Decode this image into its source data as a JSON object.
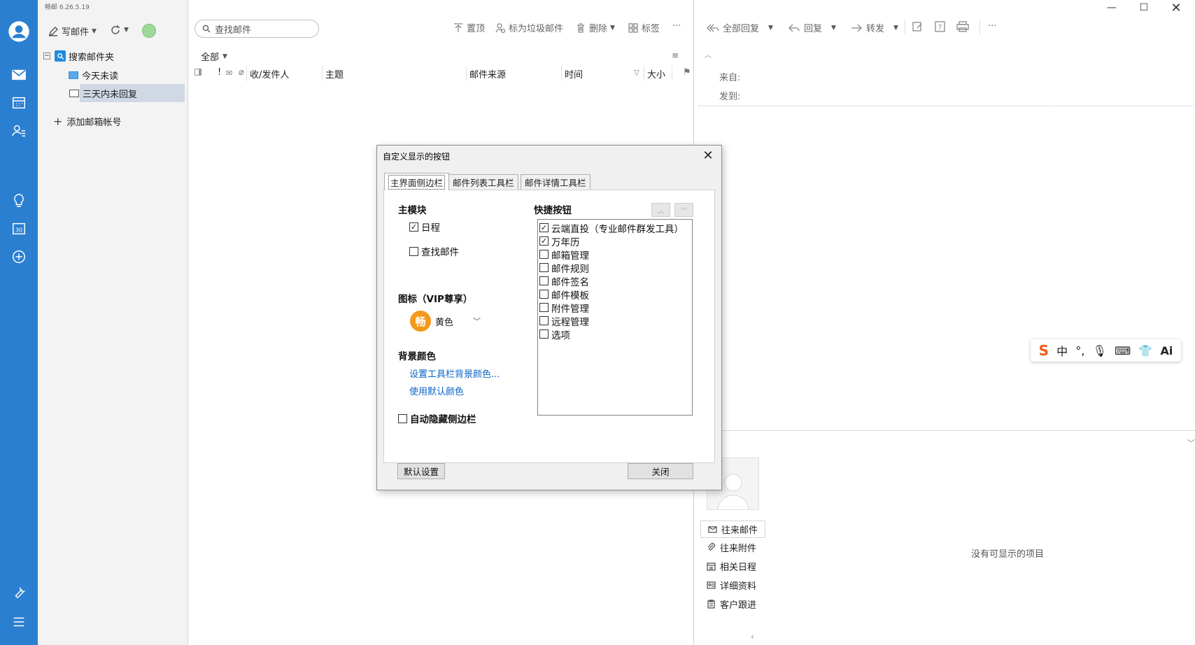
{
  "app": {
    "version": "畅邮 6.26.5.19"
  },
  "folders_toolbar": {
    "compose": "写邮件"
  },
  "folders": {
    "search_root": "搜索邮件夹",
    "items": [
      {
        "label": "今天未读"
      },
      {
        "label": "三天内未回复"
      }
    ],
    "add_account": "添加邮箱帐号"
  },
  "mail_list": {
    "search_placeholder": "查找邮件",
    "toolbar": {
      "top": "置顶",
      "spam": "标为垃圾邮件",
      "delete": "删除",
      "tags": "标签",
      "more": "···"
    },
    "filter": "全部",
    "columns": {
      "sender": "收/发件人",
      "subject": "主题",
      "source": "邮件来源",
      "time": "时间",
      "size": "大小"
    }
  },
  "reader": {
    "toolbar": {
      "reply_all": "全部回复",
      "reply": "回复",
      "forward": "转发",
      "more": "···"
    },
    "from_label": "来自:",
    "to_label": "发到:",
    "side_links": [
      "往来邮件",
      "往来附件",
      "相关日程",
      "详细资料",
      "客户跟进"
    ],
    "empty_text": "没有可显示的项目"
  },
  "ime": {
    "lang": "中"
  },
  "dialog": {
    "title": "自定义显示的按钮",
    "tabs": [
      "主界面侧边栏",
      "邮件列表工具栏",
      "邮件详情工具栏"
    ],
    "main_module_title": "主模块",
    "main_modules": [
      {
        "label": "日程",
        "checked": true
      },
      {
        "label": "查找邮件",
        "checked": false
      }
    ],
    "icon_title": "图标（VIP尊享）",
    "icon_badge": "畅",
    "icon_color": "黄色",
    "bg_title": "背景颜色",
    "bg_link_set": "设置工具栏背景颜色...",
    "bg_link_default": "使用默认颜色",
    "autohide": "自动隐藏侧边栏",
    "quick_title": "快捷按钮",
    "quick_items": [
      {
        "label": "云端直投（专业邮件群发工具）",
        "checked": true
      },
      {
        "label": "万年历",
        "checked": true
      },
      {
        "label": "邮箱管理",
        "checked": false
      },
      {
        "label": "邮件规则",
        "checked": false
      },
      {
        "label": "邮件签名",
        "checked": false
      },
      {
        "label": "邮件模板",
        "checked": false
      },
      {
        "label": "附件管理",
        "checked": false
      },
      {
        "label": "远程管理",
        "checked": false
      },
      {
        "label": "选项",
        "checked": false
      }
    ],
    "btn_default": "默认设置",
    "btn_close": "关闭"
  },
  "colors": {
    "rail": "#2b7fd1",
    "link": "#0b63c8",
    "badge": "#f39a1b"
  }
}
